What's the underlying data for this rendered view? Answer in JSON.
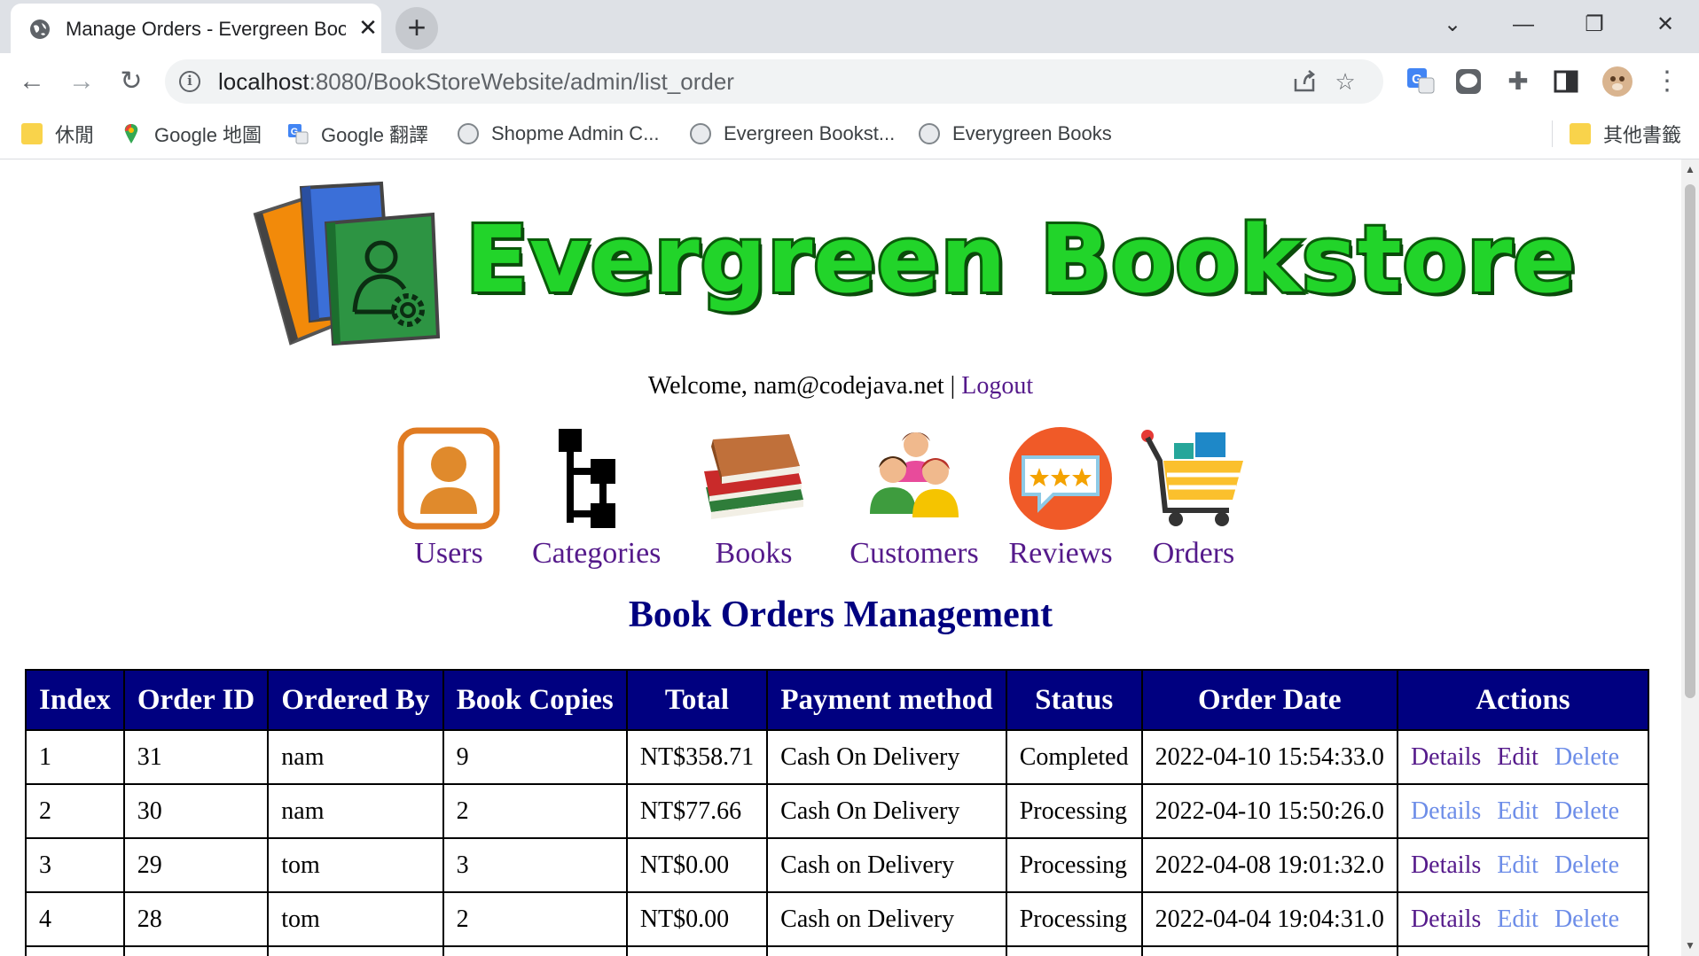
{
  "browser": {
    "tab_title": "Manage Orders - Evergreen Bookstore Administration",
    "tab_close": "✕",
    "new_tab": "+",
    "url_host": "localhost",
    "url_path": ":8080/BookStoreWebsite/admin/list_order",
    "window_controls": [
      "⌄",
      "—",
      "❐",
      "✕"
    ],
    "bookmarks": [
      {
        "label": "休閒",
        "icon": "folder-icon"
      },
      {
        "label": "Google 地圖",
        "icon": "maps-icon"
      },
      {
        "label": "Google 翻譯",
        "icon": "translate-icon"
      },
      {
        "label": "Shopme Admin C...",
        "icon": "globe-icon"
      },
      {
        "label": "Evergreen Bookst...",
        "icon": "globe-icon"
      },
      {
        "label": "Everygreen Books",
        "icon": "globe-icon"
      }
    ],
    "other_bookmarks": "其他書籤"
  },
  "site": {
    "logo_text": "Evergreen Bookstore",
    "welcome_prefix": "Welcome, nam@codejava.net",
    "separator": "|",
    "logout_label": "Logout"
  },
  "menu": [
    {
      "label": "Users",
      "icon": "users-icon"
    },
    {
      "label": "Categories",
      "icon": "categories-icon"
    },
    {
      "label": "Books",
      "icon": "books-icon"
    },
    {
      "label": "Customers",
      "icon": "customers-icon"
    },
    {
      "label": "Reviews",
      "icon": "reviews-icon"
    },
    {
      "label": "Orders",
      "icon": "orders-icon"
    }
  ],
  "heading": "Book Orders Management",
  "table": {
    "headers": [
      "Index",
      "Order ID",
      "Ordered By",
      "Book Copies",
      "Total",
      "Payment method",
      "Status",
      "Order Date",
      "Actions"
    ],
    "rows": [
      {
        "index": "1",
        "order_id": "31",
        "ordered_by": "nam",
        "copies": "9",
        "total": "NT$358.71",
        "payment": "Cash On Delivery",
        "status": "Completed",
        "date": "2022-04-10 15:54:33.0",
        "details": "Details",
        "edit": "Edit",
        "delete": "Delete"
      },
      {
        "index": "2",
        "order_id": "30",
        "ordered_by": "nam",
        "copies": "2",
        "total": "NT$77.66",
        "payment": "Cash On Delivery",
        "status": "Processing",
        "date": "2022-04-10 15:50:26.0",
        "details": "Details",
        "edit": "Edit",
        "delete": "Delete"
      },
      {
        "index": "3",
        "order_id": "29",
        "ordered_by": "tom",
        "copies": "3",
        "total": "NT$0.00",
        "payment": "Cash on Delivery",
        "status": "Processing",
        "date": "2022-04-08 19:01:32.0",
        "details": "Details",
        "edit": "Edit",
        "delete": "Delete"
      },
      {
        "index": "4",
        "order_id": "28",
        "ordered_by": "tom",
        "copies": "2",
        "total": "NT$0.00",
        "payment": "Cash on Delivery",
        "status": "Processing",
        "date": "2022-04-04 19:04:31.0",
        "details": "Details",
        "edit": "Edit",
        "delete": "Delete"
      }
    ]
  },
  "colors": {
    "header_bg": "#000080",
    "visited_link": "#551a8b",
    "unvisited_link": "#6d8de8",
    "logo_green": "#22d42a"
  }
}
